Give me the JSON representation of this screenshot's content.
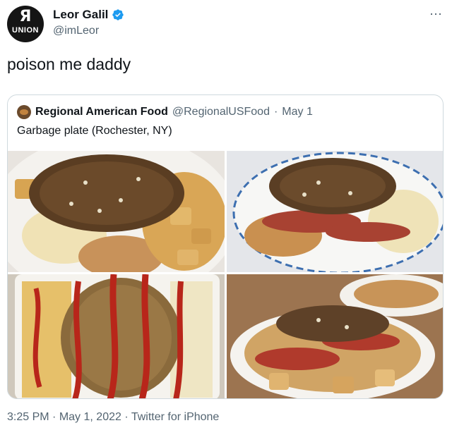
{
  "author": {
    "avatar_glyph": "Я",
    "avatar_word": "UNION",
    "name": "Leor Galil",
    "handle": "@imLeor",
    "verified_color": "#1d9bf0"
  },
  "more_icon": "⋯",
  "tweet_text": "poison me daddy",
  "quoted": {
    "name": "Regional American Food",
    "handle": "@RegionalUSFood",
    "separator": "·",
    "date": "May 1",
    "text": "Garbage plate (Rochester, NY)"
  },
  "footer": {
    "time": "3:25 PM",
    "dot1": "·",
    "date": "May 1, 2022",
    "dot2": "·",
    "source": "Twitter for iPhone"
  },
  "icons": {
    "verified": "verified-badge-icon",
    "more": "more-icon"
  }
}
